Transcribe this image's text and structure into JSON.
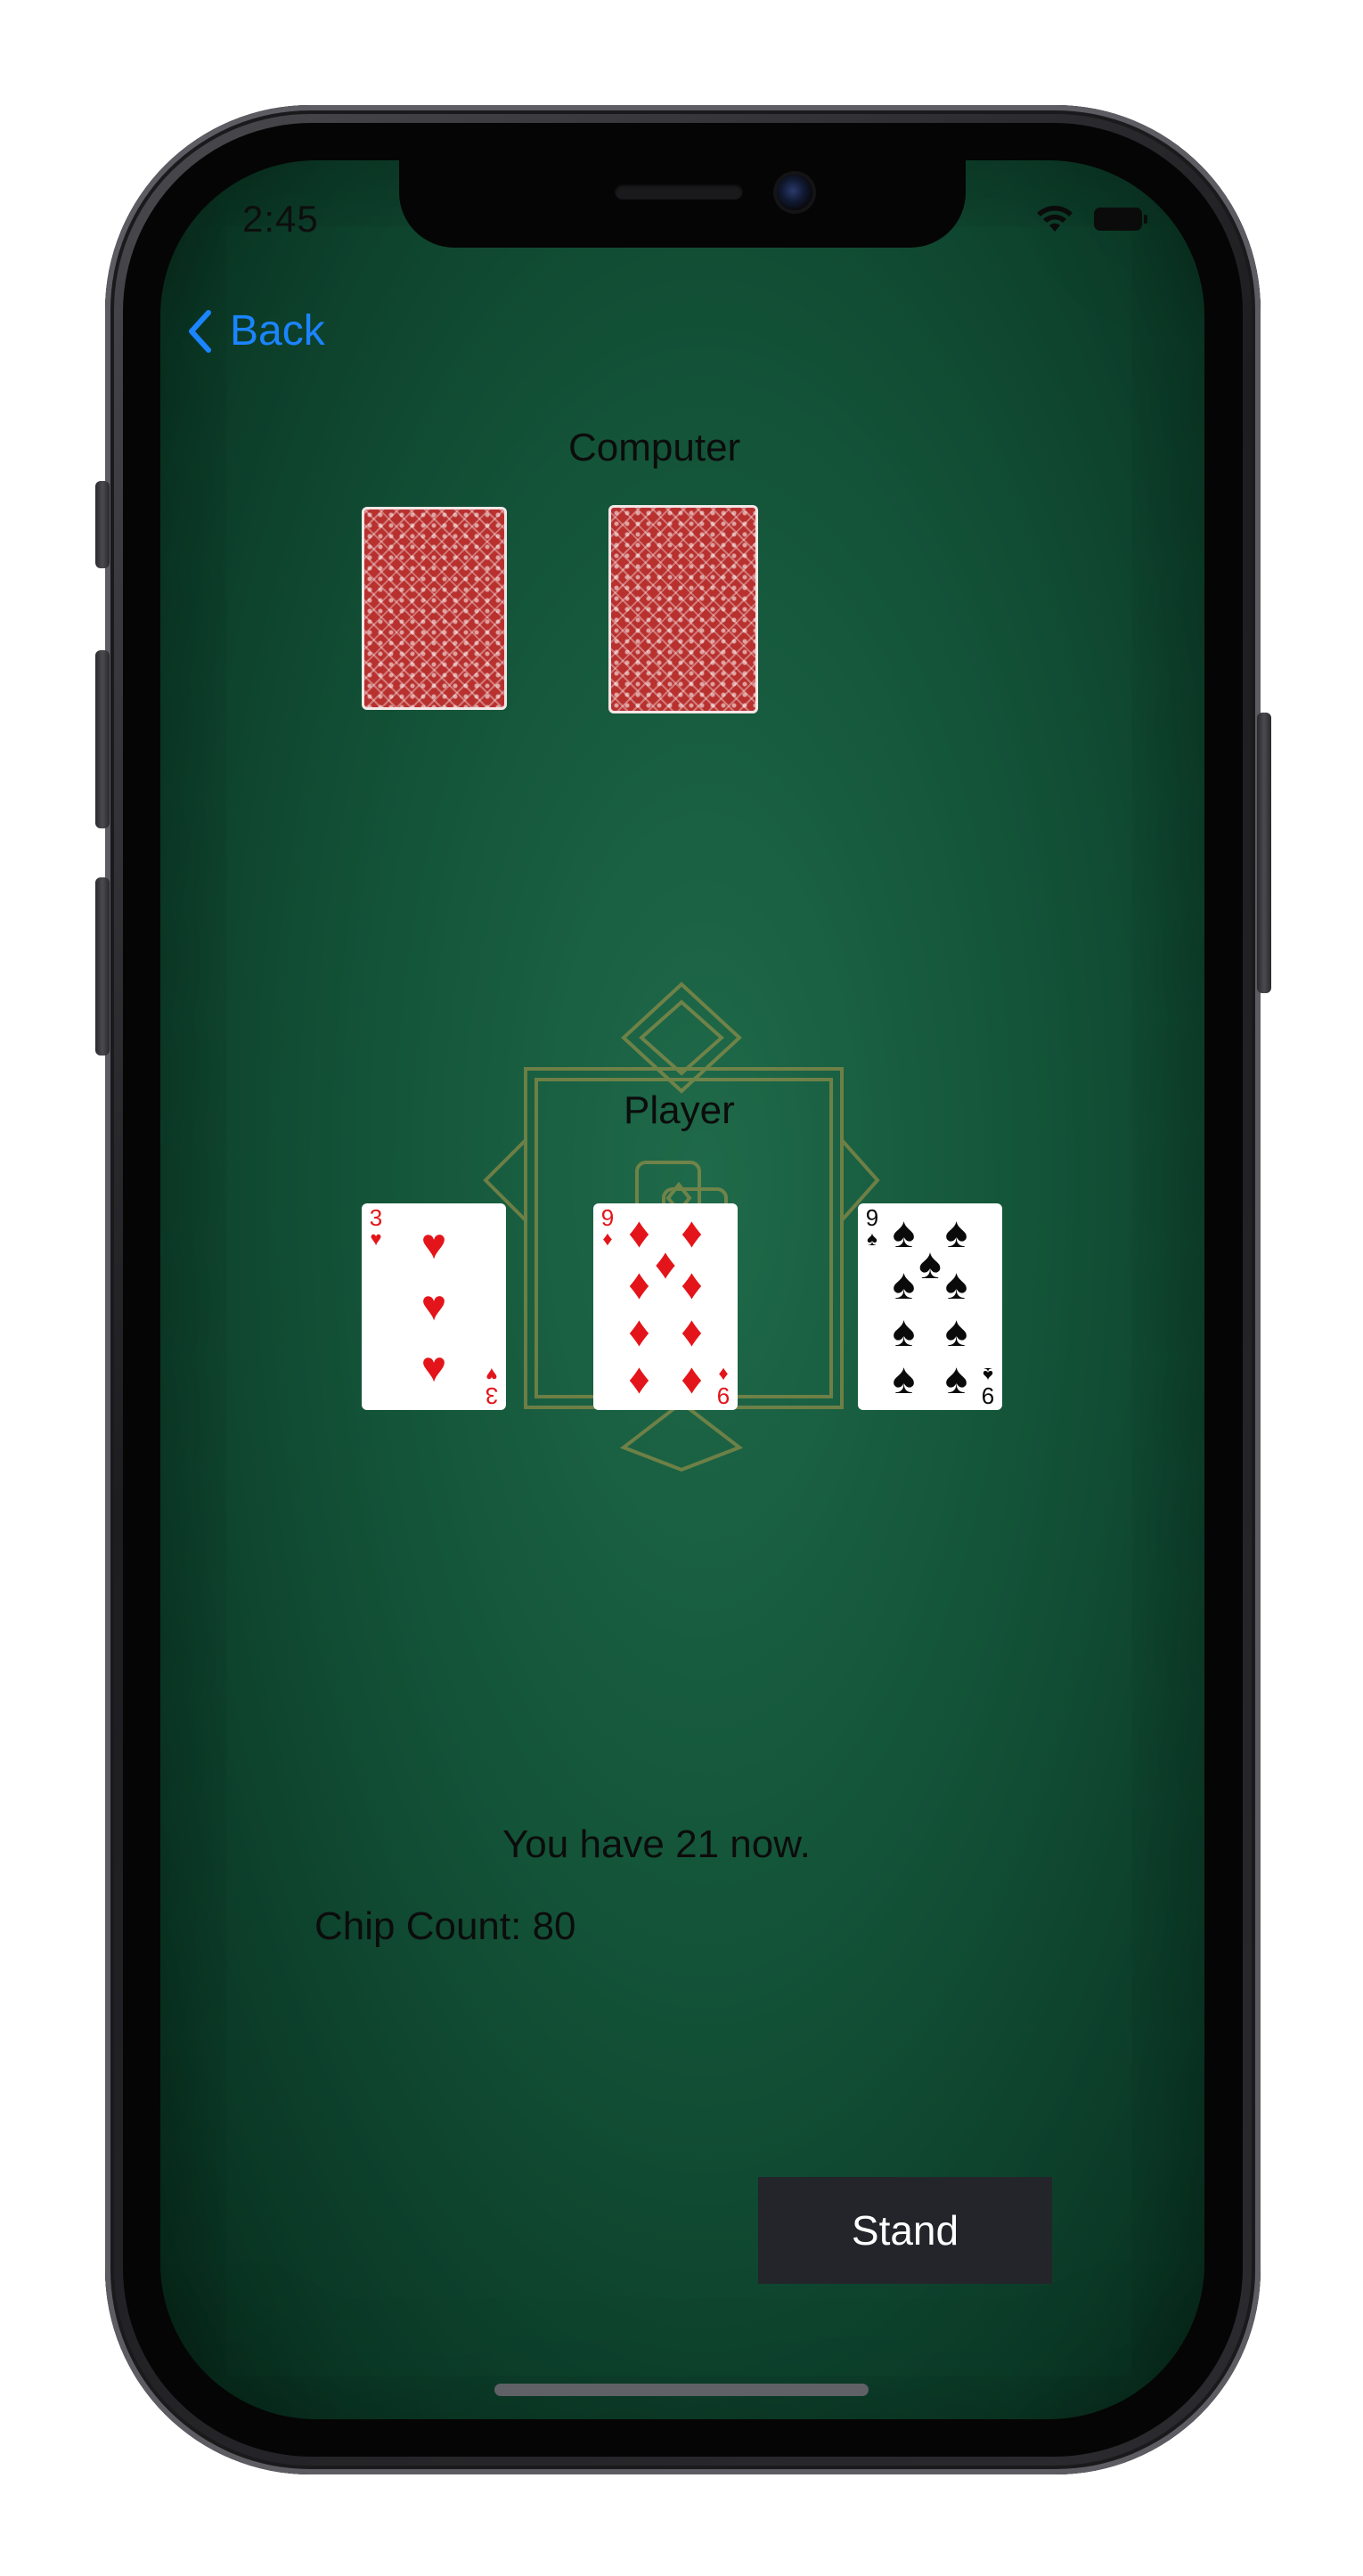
{
  "status_bar": {
    "time": "2:45"
  },
  "nav": {
    "back_label": "Back"
  },
  "computer": {
    "label": "Computer",
    "cards": [
      {
        "face": "down"
      },
      {
        "face": "down"
      }
    ]
  },
  "player": {
    "label": "Player",
    "cards": [
      {
        "rank": "3",
        "suit": "hearts",
        "suit_symbol": "♥",
        "color": "#e3151a"
      },
      {
        "rank": "9",
        "suit": "diamonds",
        "suit_symbol": "♦",
        "color": "#e3151a"
      },
      {
        "rank": "9",
        "suit": "spades",
        "suit_symbol": "♠",
        "color": "#0a0a0a"
      }
    ]
  },
  "messages": {
    "total": "You have 21 now.",
    "chips": "Chip Count: 80"
  },
  "actions": {
    "stand_label": "Stand"
  },
  "colors": {
    "table_green": "#135338",
    "accent_blue": "#1b84ff",
    "button_dark": "#23252b"
  }
}
